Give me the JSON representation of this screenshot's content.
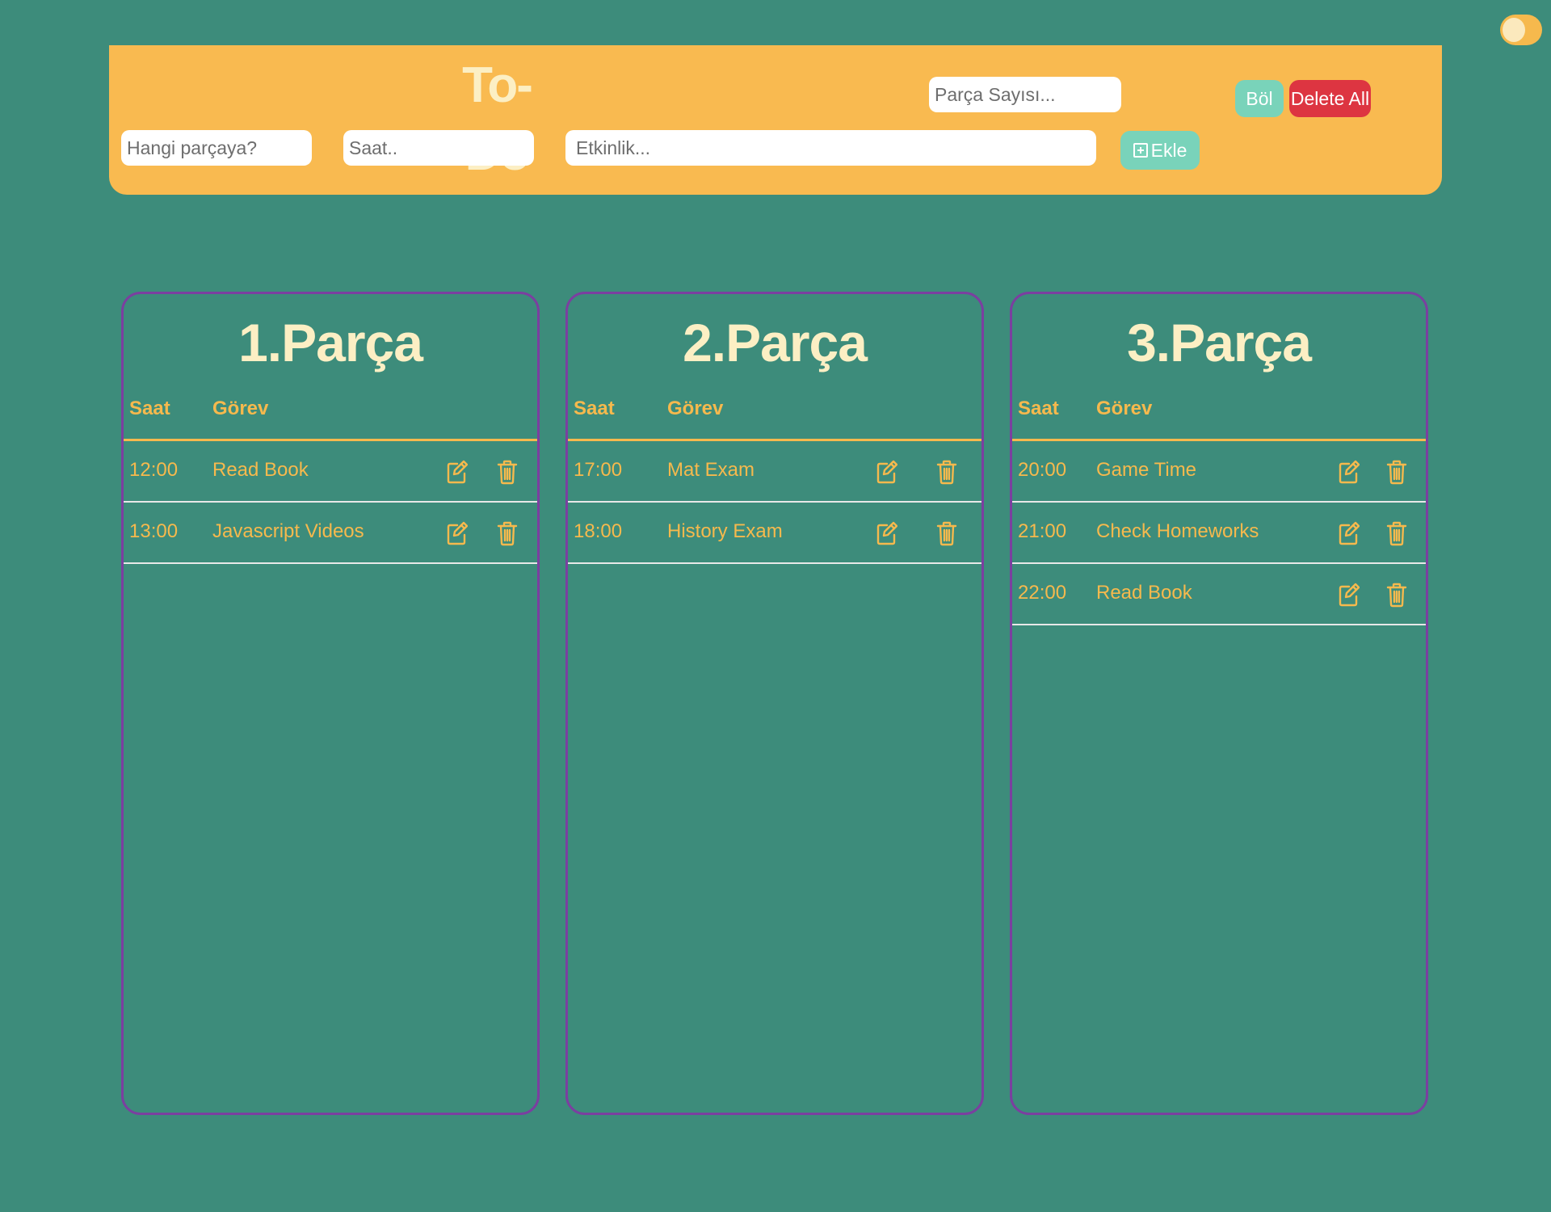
{
  "header": {
    "title": "To-Do",
    "segment_count_placeholder": "Parça Sayısı...",
    "split_button": "Böl",
    "delete_all_button": "Delete All",
    "which_segment_placeholder": "Hangi parçaya?",
    "time_placeholder": "Saat..",
    "event_placeholder": "Etkinlik...",
    "add_button": "Ekle"
  },
  "theme_toggle": {
    "icon": "toggle-switch"
  },
  "colors": {
    "background": "#3d8c7b",
    "header": "#f9ba50",
    "accent": "#f6b94d",
    "title_text": "#fcefc4",
    "panel_border": "#7b3fa0",
    "danger": "#dd3541",
    "mint": "#79d3ba"
  },
  "columns": {
    "time": "Saat",
    "task": "Görev"
  },
  "icons": {
    "edit": "edit-icon",
    "delete": "trash-icon",
    "add": "plus-square-icon"
  },
  "panels": [
    {
      "title": "1.Parça",
      "rows": [
        {
          "time": "12:00",
          "task": "Read Book"
        },
        {
          "time": "13:00",
          "task": "Javascript Videos"
        }
      ]
    },
    {
      "title": "2.Parça",
      "rows": [
        {
          "time": "17:00",
          "task": "Mat Exam"
        },
        {
          "time": "18:00",
          "task": "History Exam"
        }
      ]
    },
    {
      "title": "3.Parça",
      "rows": [
        {
          "time": "20:00",
          "task": "Game Time"
        },
        {
          "time": "21:00",
          "task": "Check Homeworks"
        },
        {
          "time": "22:00",
          "task": "Read Book"
        }
      ]
    }
  ]
}
